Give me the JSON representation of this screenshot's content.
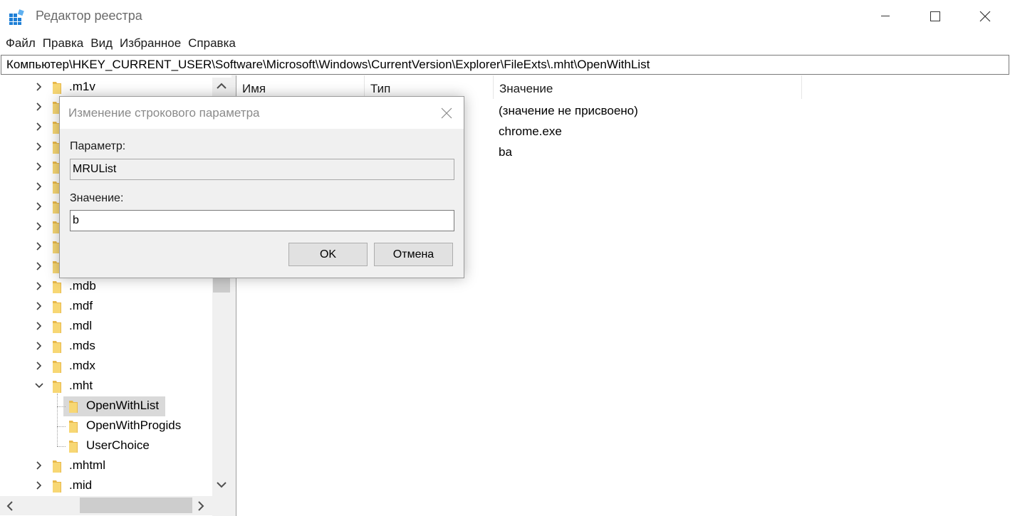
{
  "window": {
    "title": "Редактор реестра",
    "icon": "regedit-icon"
  },
  "menu": [
    "Файл",
    "Правка",
    "Вид",
    "Избранное",
    "Справка"
  ],
  "address": "Компьютер\\HKEY_CURRENT_USER\\Software\\Microsoft\\Windows\\CurrentVersion\\Explorer\\FileExts\\.mht\\OpenWithList",
  "tree": {
    "items": [
      {
        "label": ".m1v",
        "state": "collapsed"
      },
      {
        "label": "",
        "state": "collapsed"
      },
      {
        "label": "",
        "state": "collapsed"
      },
      {
        "label": "",
        "state": "collapsed"
      },
      {
        "label": "",
        "state": "collapsed"
      },
      {
        "label": "",
        "state": "collapsed"
      },
      {
        "label": "",
        "state": "collapsed"
      },
      {
        "label": "",
        "state": "collapsed"
      },
      {
        "label": "",
        "state": "collapsed"
      },
      {
        "label": "",
        "state": "collapsed"
      },
      {
        "label": ".mdb",
        "state": "collapsed"
      },
      {
        "label": ".mdf",
        "state": "collapsed"
      },
      {
        "label": ".mdl",
        "state": "collapsed"
      },
      {
        "label": ".mds",
        "state": "collapsed"
      },
      {
        "label": ".mdx",
        "state": "collapsed"
      },
      {
        "label": ".mht",
        "state": "expanded"
      },
      {
        "label": "OpenWithList",
        "state": "child-selected"
      },
      {
        "label": "OpenWithProgids",
        "state": "child"
      },
      {
        "label": "UserChoice",
        "state": "child"
      },
      {
        "label": ".mhtml",
        "state": "collapsed"
      },
      {
        "label": ".mid",
        "state": "collapsed"
      }
    ]
  },
  "list": {
    "headers": {
      "name": "Имя",
      "type": "Тип",
      "value": "Значение"
    },
    "values": [
      "(значение не присвоено)",
      "chrome.exe",
      "ba"
    ]
  },
  "dialog": {
    "title": "Изменение строкового параметра",
    "param_label": "Параметр:",
    "param_value": "MRUList",
    "value_label": "Значение:",
    "value_value": "b",
    "ok": "OK",
    "cancel": "Отмена"
  },
  "colors": {
    "folder": "#f7d774",
    "selection": "#d9d9d9",
    "icon_blue": "#1e7fd6"
  }
}
